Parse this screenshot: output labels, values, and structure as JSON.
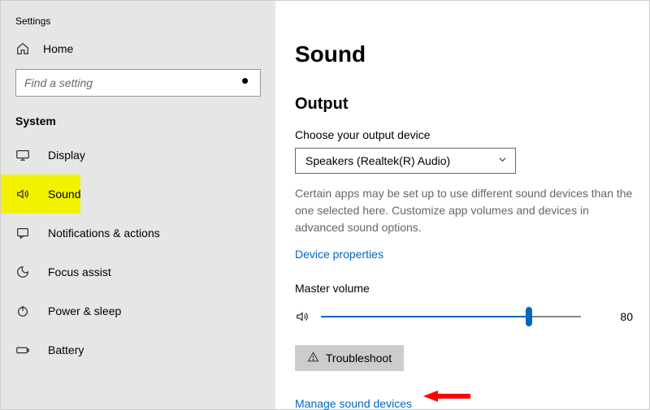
{
  "app": {
    "title": "Settings"
  },
  "sidebar": {
    "home": "Home",
    "search_placeholder": "Find a setting",
    "heading": "System",
    "items": [
      {
        "label": "Display",
        "icon": "display-icon"
      },
      {
        "label": "Sound",
        "icon": "sound-icon",
        "active": true
      },
      {
        "label": "Notifications & actions",
        "icon": "notifications-icon"
      },
      {
        "label": "Focus assist",
        "icon": "focus-icon"
      },
      {
        "label": "Power & sleep",
        "icon": "power-icon"
      },
      {
        "label": "Battery",
        "icon": "battery-icon"
      }
    ]
  },
  "content": {
    "page_title": "Sound",
    "output": {
      "section_title": "Output",
      "device_label": "Choose your output device",
      "device_selected": "Speakers (Realtek(R) Audio)",
      "helper": "Certain apps may be set up to use different sound devices than the one selected here. Customize app volumes and devices in advanced sound options.",
      "device_props_link": "Device properties",
      "master_volume_label": "Master volume",
      "master_volume_value": "80",
      "troubleshoot_label": "Troubleshoot",
      "manage_link": "Manage sound devices"
    }
  }
}
